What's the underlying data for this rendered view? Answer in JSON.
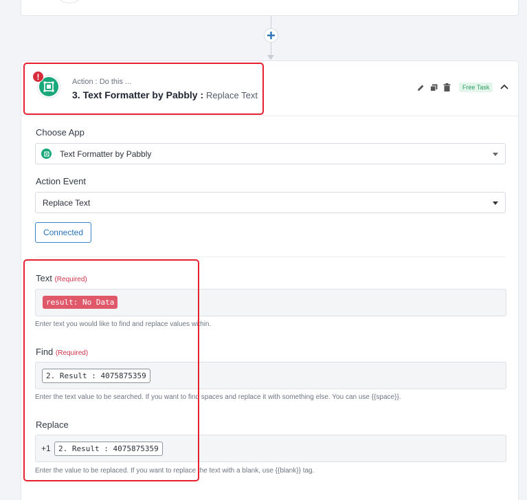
{
  "action": {
    "label": "Action : Do this ...",
    "title": "3. Text Formatter by Pabbly :",
    "subtitle": "Replace Text",
    "badge": "Free Task",
    "error_mark": "!"
  },
  "choose_app": {
    "label": "Choose App",
    "value": "Text Formatter by Pabbly"
  },
  "action_event": {
    "label": "Action Event",
    "value": "Replace Text"
  },
  "connected_button": "Connected",
  "required_text": "(Required)",
  "fields": {
    "text": {
      "label": "Text",
      "chip": "result: No Data",
      "help": "Enter text you would like to find and replace values within."
    },
    "find": {
      "label": "Find",
      "chip": "2. Result : 4075875359",
      "help": "Enter the text value to be searched. If you want to find spaces and replace it with something else. You can use {{space}}."
    },
    "replace": {
      "label": "Replace",
      "prefix": "+1",
      "chip": "2. Result : 4075875359",
      "help": "Enter the value to be replaced. If you want to replace the text with a blank, use {{blank}} tag."
    }
  },
  "colors": {
    "accent": "#2a73b8",
    "highlight": "#e5202f",
    "app_green": "#1aa77a",
    "error_red": "#d82c3c"
  },
  "icons": {
    "add_step": "plus-icon",
    "edit": "pencil-icon",
    "copy": "copy-icon",
    "delete": "trash-icon",
    "collapse": "chevron-up-icon",
    "dropdown": "caret-down-icon"
  }
}
